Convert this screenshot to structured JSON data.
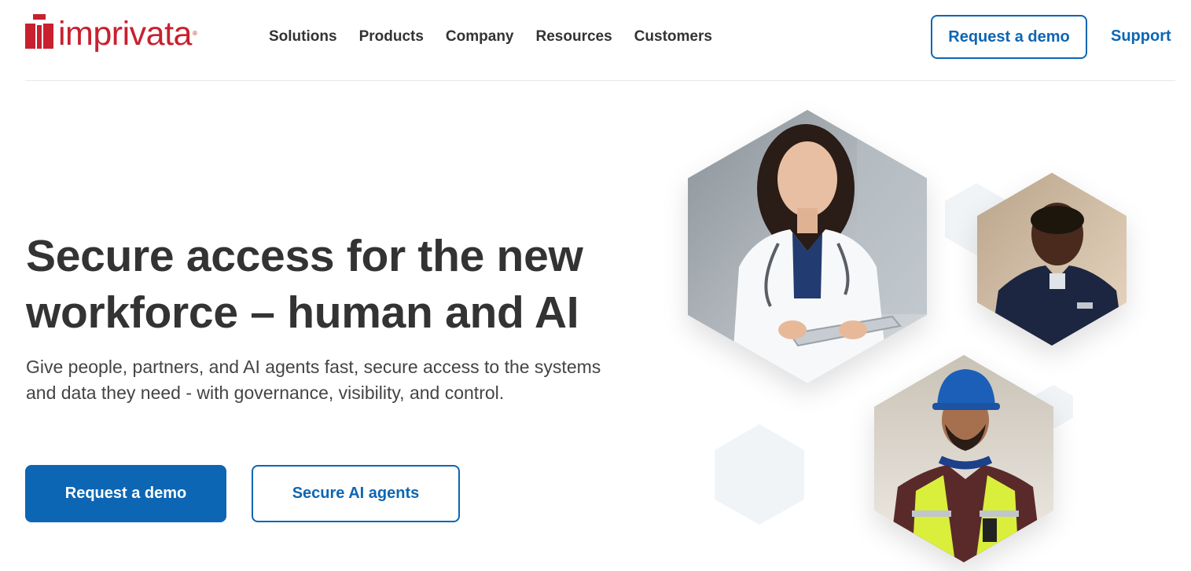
{
  "brand": {
    "name": "imprivata",
    "registered": "®",
    "color": "#c8202f"
  },
  "nav": {
    "items": [
      {
        "label": "Solutions"
      },
      {
        "label": "Products"
      },
      {
        "label": "Company"
      },
      {
        "label": "Resources"
      },
      {
        "label": "Customers"
      }
    ]
  },
  "header": {
    "request_demo_label": "Request a demo",
    "support_label": "Support"
  },
  "hero": {
    "title_line1": "Secure access for the new",
    "title_line2": "workforce – human and AI",
    "subtitle": "Give people, partners, and AI agents fast, secure access to the systems and data they need - with governance, visibility, and control.",
    "primary_cta": "Request a demo",
    "secondary_cta": "Secure AI agents"
  },
  "images": [
    {
      "icon": "doctor-with-tablet-photo"
    },
    {
      "icon": "police-officer-photo"
    },
    {
      "icon": "construction-worker-photo"
    }
  ],
  "colors": {
    "accent": "#0d66b3",
    "text": "#333333",
    "brand_red": "#c8202f"
  }
}
